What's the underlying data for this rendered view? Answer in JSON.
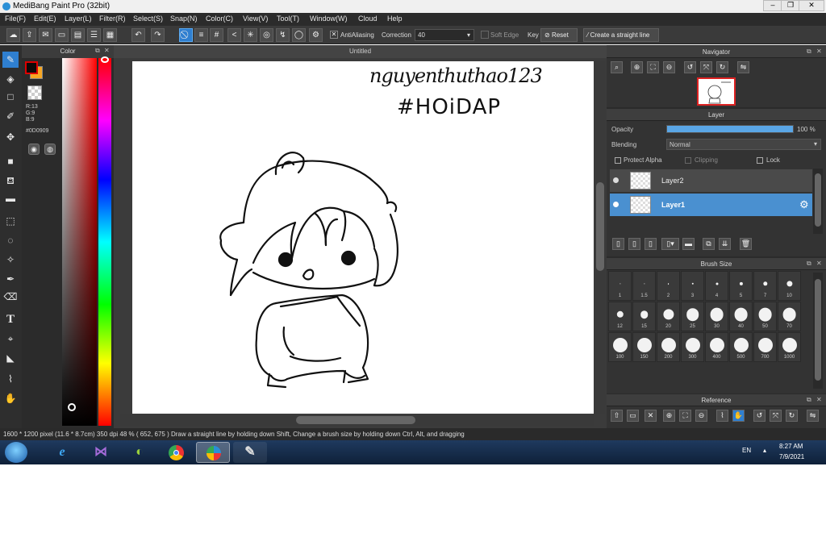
{
  "window": {
    "title": "MediBang Paint Pro (32bit)"
  },
  "menu": [
    "File(F)",
    "Edit(E)",
    "Layer(L)",
    "Filter(R)",
    "Select(S)",
    "Snap(N)",
    "Color(C)",
    "View(V)",
    "Tool(T)",
    "Window(W)",
    "Cloud",
    "Help"
  ],
  "toolbar": {
    "antialiasing_label": "AntiAliasing",
    "correction_label": "Correction",
    "correction_value": "40",
    "soft_edge_label": "Soft Edge",
    "key_label": "Key",
    "reset_label": "Reset",
    "straight_line_label": "Create a straight line"
  },
  "color_panel": {
    "title": "Color",
    "r": "R:13",
    "g": "G:9",
    "b": "B:9",
    "hex": "#0D0909",
    "main_color": "#0d0909",
    "sub_color": "#f6a623"
  },
  "canvas": {
    "tab_title": "Untitled",
    "handwriting_line1": "nguyenthuthao123",
    "handwriting_line2": "#HOiDAP"
  },
  "navigator": {
    "title": "Navigator"
  },
  "layer_panel": {
    "title": "Layer",
    "opacity_label": "Opacity",
    "opacity_value": "100 %",
    "opacity_fraction": 1.0,
    "blending_label": "Blending",
    "blending_value": "Normal",
    "protect_alpha": "Protect Alpha",
    "clipping": "Clipping",
    "lock": "Lock",
    "layers": [
      {
        "name": "Layer2",
        "selected": false
      },
      {
        "name": "Layer1",
        "selected": true
      }
    ]
  },
  "brush_size": {
    "title": "Brush Size",
    "sizes": [
      "1",
      "1.5",
      "2",
      "3",
      "4",
      "5",
      "7",
      "10",
      "12",
      "15",
      "20",
      "25",
      "30",
      "40",
      "50",
      "70",
      "100",
      "150",
      "200",
      "300",
      "400",
      "500",
      "700",
      "1000"
    ]
  },
  "reference": {
    "title": "Reference"
  },
  "status": {
    "text": "1600 * 1200 pixel   (11.6 * 8.7cm)   350 dpi   48 %   ( 652, 675 )   Draw a straight line by holding down Shift, Change a brush size by holding down Ctrl, Alt, and dragging"
  },
  "taskbar": {
    "lang": "EN",
    "time": "8:27 AM",
    "date": "7/9/2021"
  },
  "colors": {
    "accent": "#2f7fd0",
    "selected_layer": "#4a90d0"
  }
}
